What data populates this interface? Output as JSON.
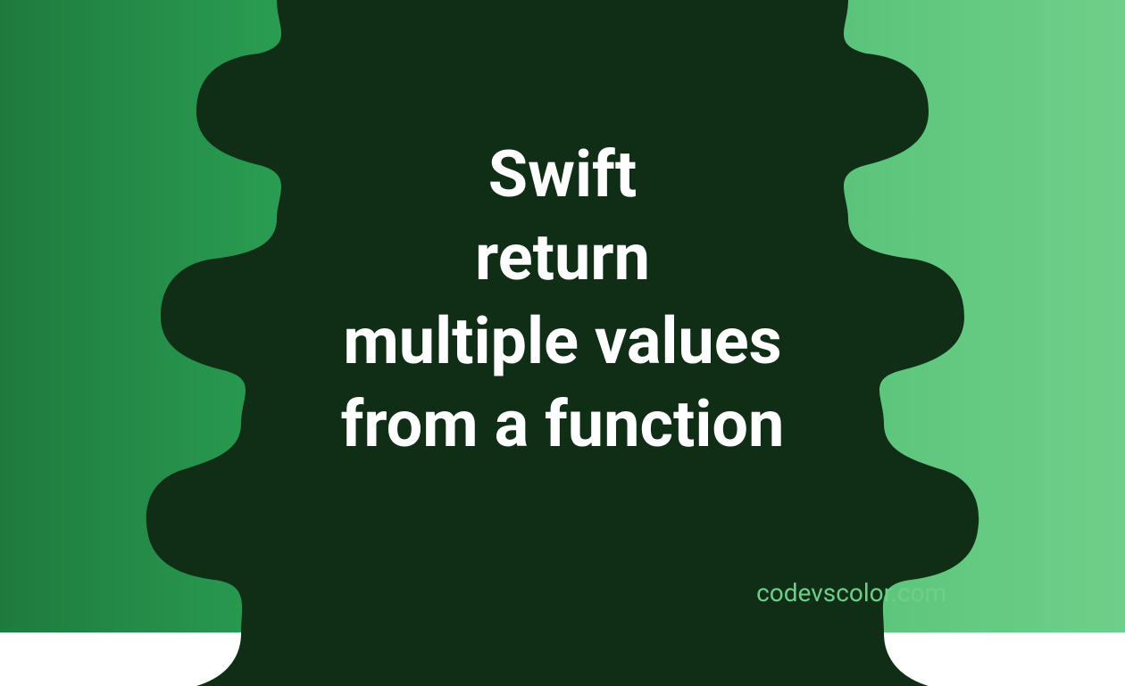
{
  "title_lines": {
    "line1": "Swift",
    "line2": "return",
    "line3": "multiple values",
    "line4": "from a function"
  },
  "website": "codevscolor.com",
  "colors": {
    "blob": "#102d16",
    "text": "#ffffff",
    "accent": "#6fcf8a"
  }
}
